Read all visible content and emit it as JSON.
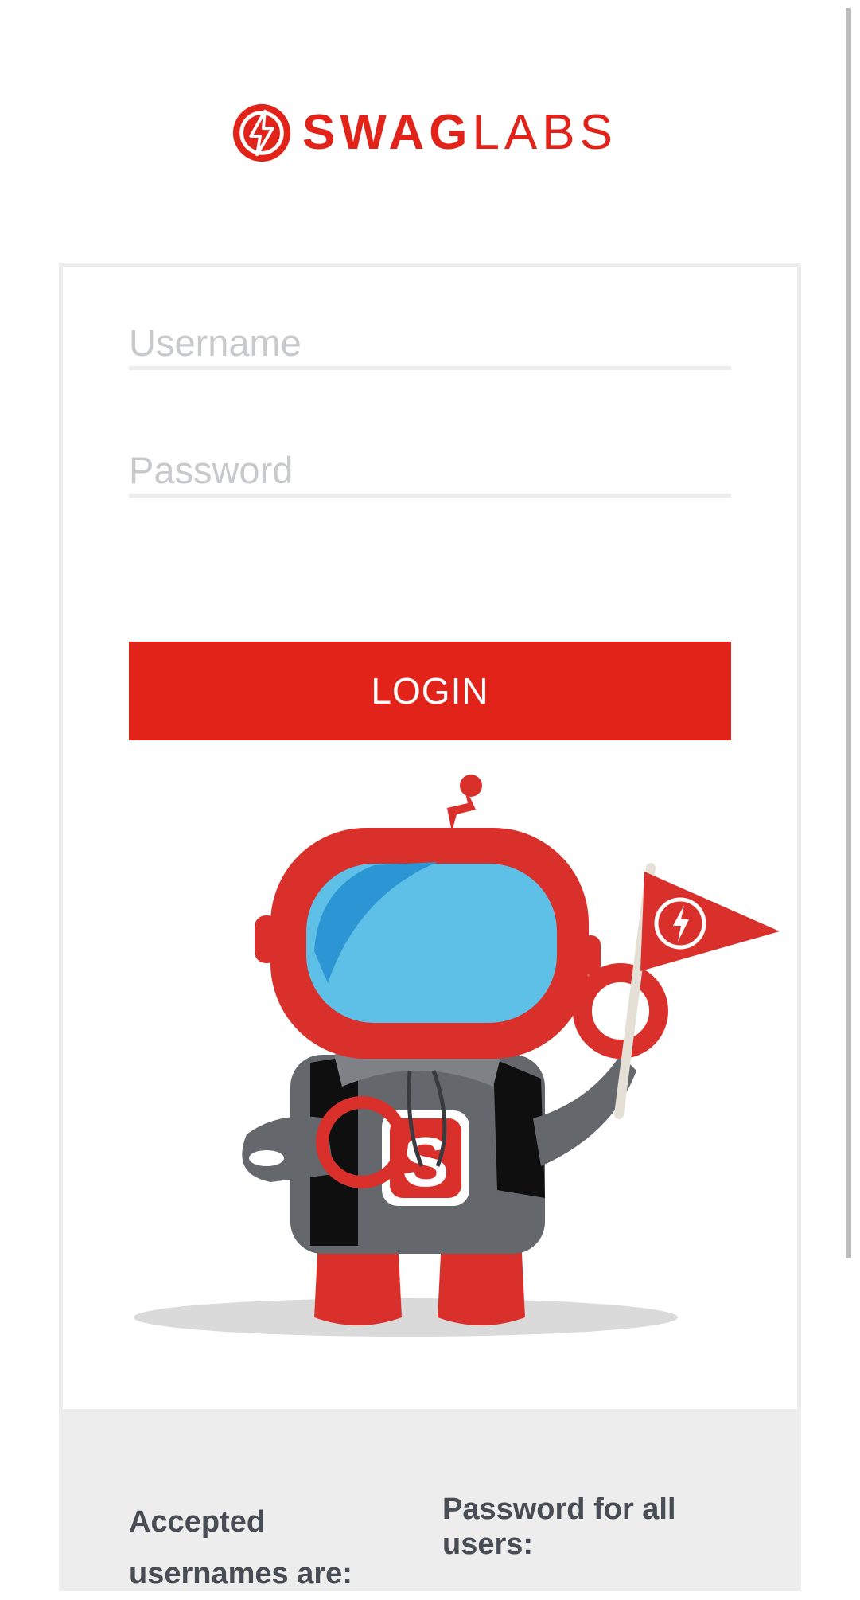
{
  "brand": {
    "bold": "SWAG",
    "light": "LABS",
    "color": "#e2231a"
  },
  "login_form": {
    "username_placeholder": "Username",
    "password_placeholder": "Password",
    "login_label": "LOGIN"
  },
  "credentials_info": {
    "usernames_heading": "Accepted usernames are:",
    "password_heading": "Password for all users:"
  },
  "icons": [
    "swag-labs-logo-icon",
    "robot-mascot-icon"
  ]
}
